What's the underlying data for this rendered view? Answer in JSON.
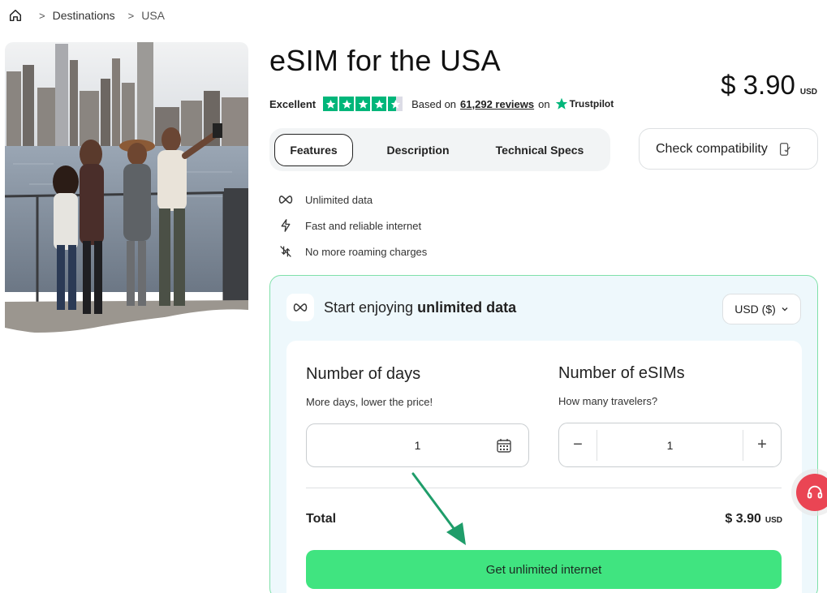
{
  "breadcrumb": {
    "home_icon": "home-icon",
    "items": [
      "Destinations",
      "USA"
    ]
  },
  "product": {
    "title": "eSIM for the USA",
    "price": "$ 3.90",
    "price_currency": "USD"
  },
  "rating": {
    "label": "Excellent",
    "stars": 4.5,
    "based_on": "Based on",
    "reviews": "61,292 reviews",
    "on": "on",
    "provider": "Trustpilot",
    "star_color": "#00b67a"
  },
  "tabs": [
    {
      "label": "Features",
      "active": true
    },
    {
      "label": "Description",
      "active": false
    },
    {
      "label": "Technical Specs",
      "active": false
    }
  ],
  "compatibility": {
    "label": "Check compatibility",
    "icon": "phone-check-icon"
  },
  "features": [
    {
      "icon": "infinity-icon",
      "label": "Unlimited data"
    },
    {
      "icon": "lightning-icon",
      "label": "Fast and reliable internet"
    },
    {
      "icon": "no-roaming-icon",
      "label": "No more roaming charges"
    }
  ],
  "plan": {
    "heading_prefix": "Start enjoying ",
    "heading_bold": "unlimited data",
    "currency_select": "USD ($)",
    "days_title": "Number of days",
    "days_sub": "More days, lower the price!",
    "days_value": "1",
    "esims_title": "Number of eSIMs",
    "esims_sub": "How many travelers?",
    "esims_value": "1",
    "minus": "−",
    "plus": "+",
    "total_label": "Total",
    "total_value": "$ 3.90",
    "total_currency": "USD",
    "cta": "Get unlimited internet"
  },
  "colors": {
    "cta": "#40e480",
    "card_border": "#7fe0a9",
    "card_bg": "#eef8fc",
    "annotation_arrow": "#1f9d6a",
    "support": "#ea4554"
  }
}
